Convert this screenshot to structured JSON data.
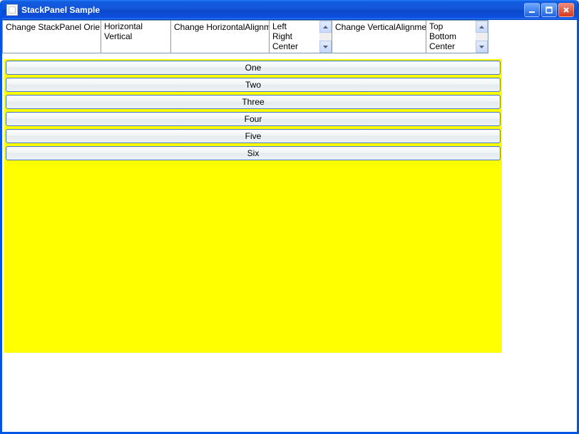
{
  "titlebar": {
    "title": "StackPanel Sample"
  },
  "controls": {
    "orientation": {
      "label": "Change StackPanel Orientation:",
      "options": [
        "Horizontal",
        "Vertical"
      ]
    },
    "halign": {
      "label": "Change HorizontalAlignment:",
      "options": [
        "Left",
        "Right",
        "Center"
      ]
    },
    "valign": {
      "label": "Change VerticalAlignment:",
      "options": [
        "Top",
        "Bottom",
        "Center"
      ]
    }
  },
  "stack": {
    "buttons": [
      "One",
      "Two",
      "Three",
      "Four",
      "Five",
      "Six"
    ]
  }
}
